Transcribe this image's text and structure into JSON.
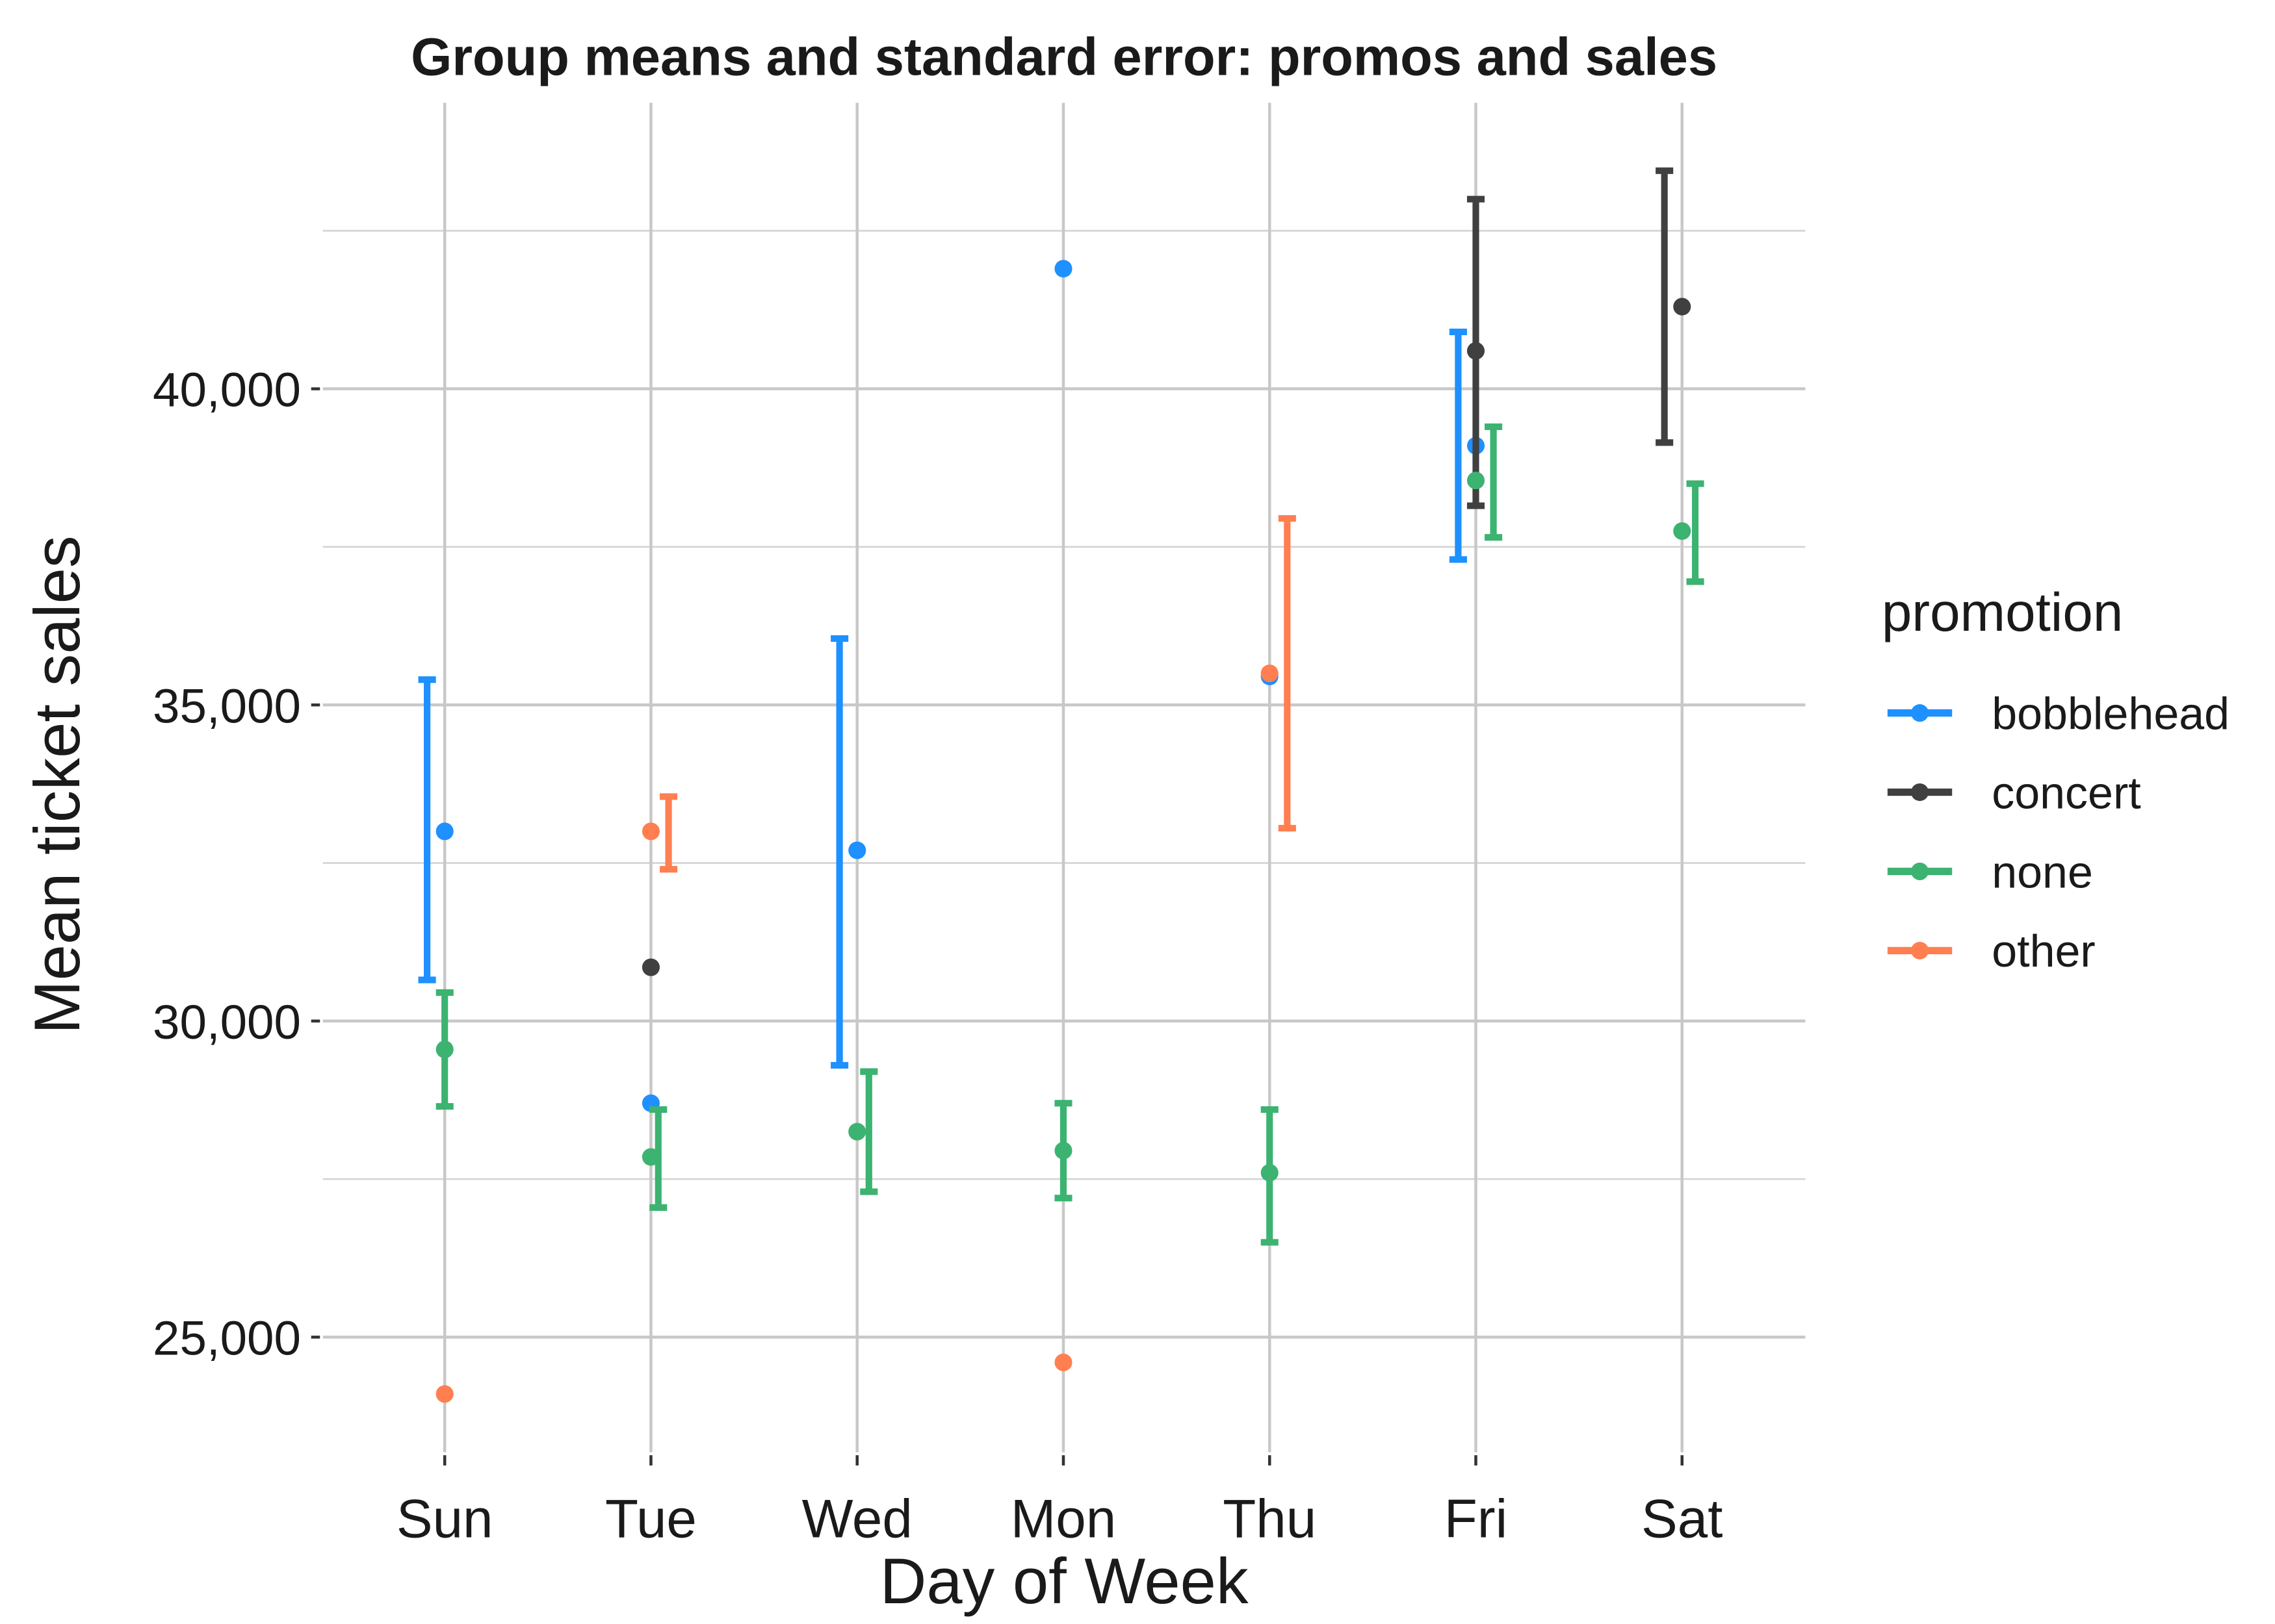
{
  "chart_data": {
    "type": "scatter",
    "title": "Group means and standard error: promos and sales",
    "xlabel": "Day of Week",
    "ylabel": "Mean ticket sales",
    "categories": [
      "Sun",
      "Tue",
      "Wed",
      "Mon",
      "Thu",
      "Fri",
      "Sat"
    ],
    "yticks": [
      25000,
      30000,
      35000,
      40000
    ],
    "ytick_labels": [
      "25,000",
      "30,000",
      "35,000",
      "40,000"
    ],
    "ylim": [
      23000,
      43500
    ],
    "grid": true,
    "legend": {
      "title": "promotion",
      "placement": "right"
    },
    "series": [
      {
        "name": "bobblehead",
        "color": "#1E90FF",
        "points": [
          {
            "day": "Sun",
            "mean": 33000,
            "lower": 30650,
            "upper": 35400
          },
          {
            "day": "Tue",
            "mean": 28700
          },
          {
            "day": "Wed",
            "mean": 32700,
            "lower": 29300,
            "upper": 36050
          },
          {
            "day": "Mon",
            "mean": 41900
          },
          {
            "day": "Thu",
            "mean": 35450
          },
          {
            "day": "Fri",
            "mean": 39100,
            "lower": 37300,
            "upper": 40900
          }
        ]
      },
      {
        "name": "concert",
        "color": "#404040",
        "points": [
          {
            "day": "Tue",
            "mean": 30850
          },
          {
            "day": "Fri",
            "mean": 40600,
            "lower": 38150,
            "upper": 43000
          },
          {
            "day": "Sat",
            "mean": 41300,
            "lower": 39150,
            "upper": 43450
          }
        ]
      },
      {
        "name": "none",
        "color": "#3CB371",
        "points": [
          {
            "day": "Sun",
            "mean": 29550,
            "lower": 28650,
            "upper": 30450
          },
          {
            "day": "Tue",
            "mean": 27850,
            "lower": 27050,
            "upper": 28600
          },
          {
            "day": "Wed",
            "mean": 28250,
            "lower": 27300,
            "upper": 29200
          },
          {
            "day": "Mon",
            "mean": 27950,
            "lower": 27200,
            "upper": 28700
          },
          {
            "day": "Thu",
            "mean": 27600,
            "lower": 26500,
            "upper": 28600
          },
          {
            "day": "Fri",
            "mean": 38550,
            "lower": 37650,
            "upper": 39400
          },
          {
            "day": "Sat",
            "mean": 37750,
            "lower": 36950,
            "upper": 38500
          }
        ]
      },
      {
        "name": "other",
        "color": "#FF7F50",
        "points": [
          {
            "day": "Sun",
            "mean": 24100
          },
          {
            "day": "Tue",
            "mean": 33000,
            "lower": 32400,
            "upper": 33550
          },
          {
            "day": "Mon",
            "mean": 24600
          },
          {
            "day": "Thu",
            "mean": 35500,
            "lower": 33050,
            "upper": 37950
          }
        ]
      }
    ]
  }
}
